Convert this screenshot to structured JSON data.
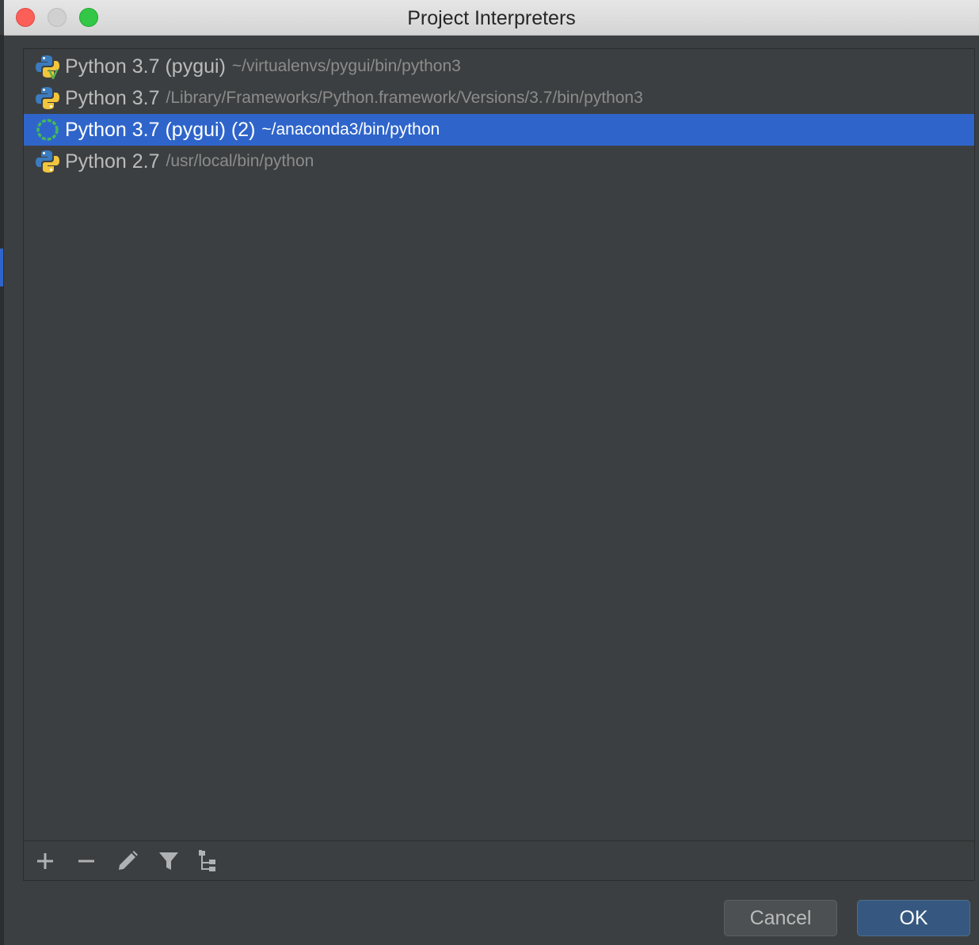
{
  "window": {
    "title": "Project Interpreters"
  },
  "interpreters": [
    {
      "name": "Python 3.7 (pygui)",
      "path": "~/virtualenvs/pygui/bin/python3",
      "icon": "python-virtualenv-icon"
    },
    {
      "name": "Python 3.7",
      "path": "/Library/Frameworks/Python.framework/Versions/3.7/bin/python3",
      "icon": "python-icon"
    },
    {
      "name": "Python 3.7 (pygui) (2)",
      "path": "~/anaconda3/bin/python",
      "icon": "conda-icon",
      "selected": true
    },
    {
      "name": "Python 2.7",
      "path": "/usr/local/bin/python",
      "icon": "python-icon"
    }
  ],
  "toolbar": {
    "icons": [
      "add-icon",
      "remove-icon",
      "edit-icon",
      "filter-icon",
      "show-paths-icon"
    ]
  },
  "buttons": {
    "cancel": "Cancel",
    "ok": "OK"
  },
  "colors": {
    "selection": "#2f65ca",
    "ok_button": "#365880",
    "background": "#3c3f41"
  }
}
